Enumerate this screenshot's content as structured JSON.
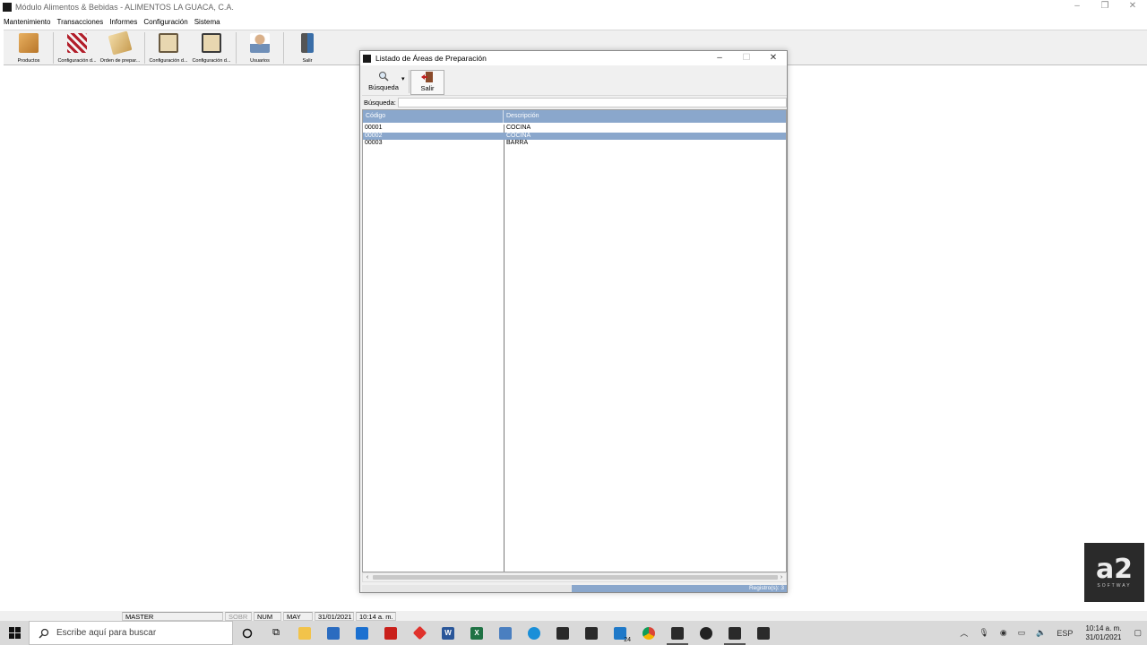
{
  "app": {
    "title": "Módulo Alimentos & Bebidas - ALIMENTOS LA GUACA, C.A."
  },
  "menu": [
    "Mantenimiento",
    "Transacciones",
    "Informes",
    "Configuración",
    "Sistema"
  ],
  "toolbar": [
    {
      "label": "Productos",
      "icon": "box-icon"
    },
    {
      "label": "Configuración d...",
      "icon": "config-table-icon"
    },
    {
      "label": "Orden de prepar...",
      "icon": "order-icon"
    },
    {
      "label": "Configuración d...",
      "icon": "config-screen-icon"
    },
    {
      "label": "Configuración d...",
      "icon": "config-screen-icon"
    },
    {
      "label": "Usuarios",
      "icon": "user-icon"
    },
    {
      "label": "Salir",
      "icon": "exit-icon"
    }
  ],
  "dialog": {
    "title": "Listado de Áreas de Preparación",
    "toolbar": {
      "search_label": "Búsqueda",
      "exit_label": "Salir"
    },
    "search": {
      "label": "Búsqueda:",
      "value": ""
    },
    "columns": [
      "Código",
      "Descripción"
    ],
    "rows": [
      {
        "code": "00001",
        "desc": "COCINA",
        "selected": false
      },
      {
        "code": "00002",
        "desc": "COCINA",
        "selected": true
      },
      {
        "code": "00003",
        "desc": "BARRA",
        "selected": false
      }
    ],
    "status": "Registro(s): 3"
  },
  "statusbar": {
    "user": "MASTER",
    "sobr": "SOBR",
    "num": "NUM",
    "may": "MAY",
    "date": "31/01/2021",
    "time": "10:14 a. m."
  },
  "taskbar": {
    "search_placeholder": "Escribe aquí para buscar",
    "lang": "ESP",
    "clock_time": "10:14 a. m.",
    "clock_date": "31/01/2021",
    "badge": "24"
  },
  "brand": {
    "name": "a2",
    "tagline": "SOFTWAY"
  }
}
